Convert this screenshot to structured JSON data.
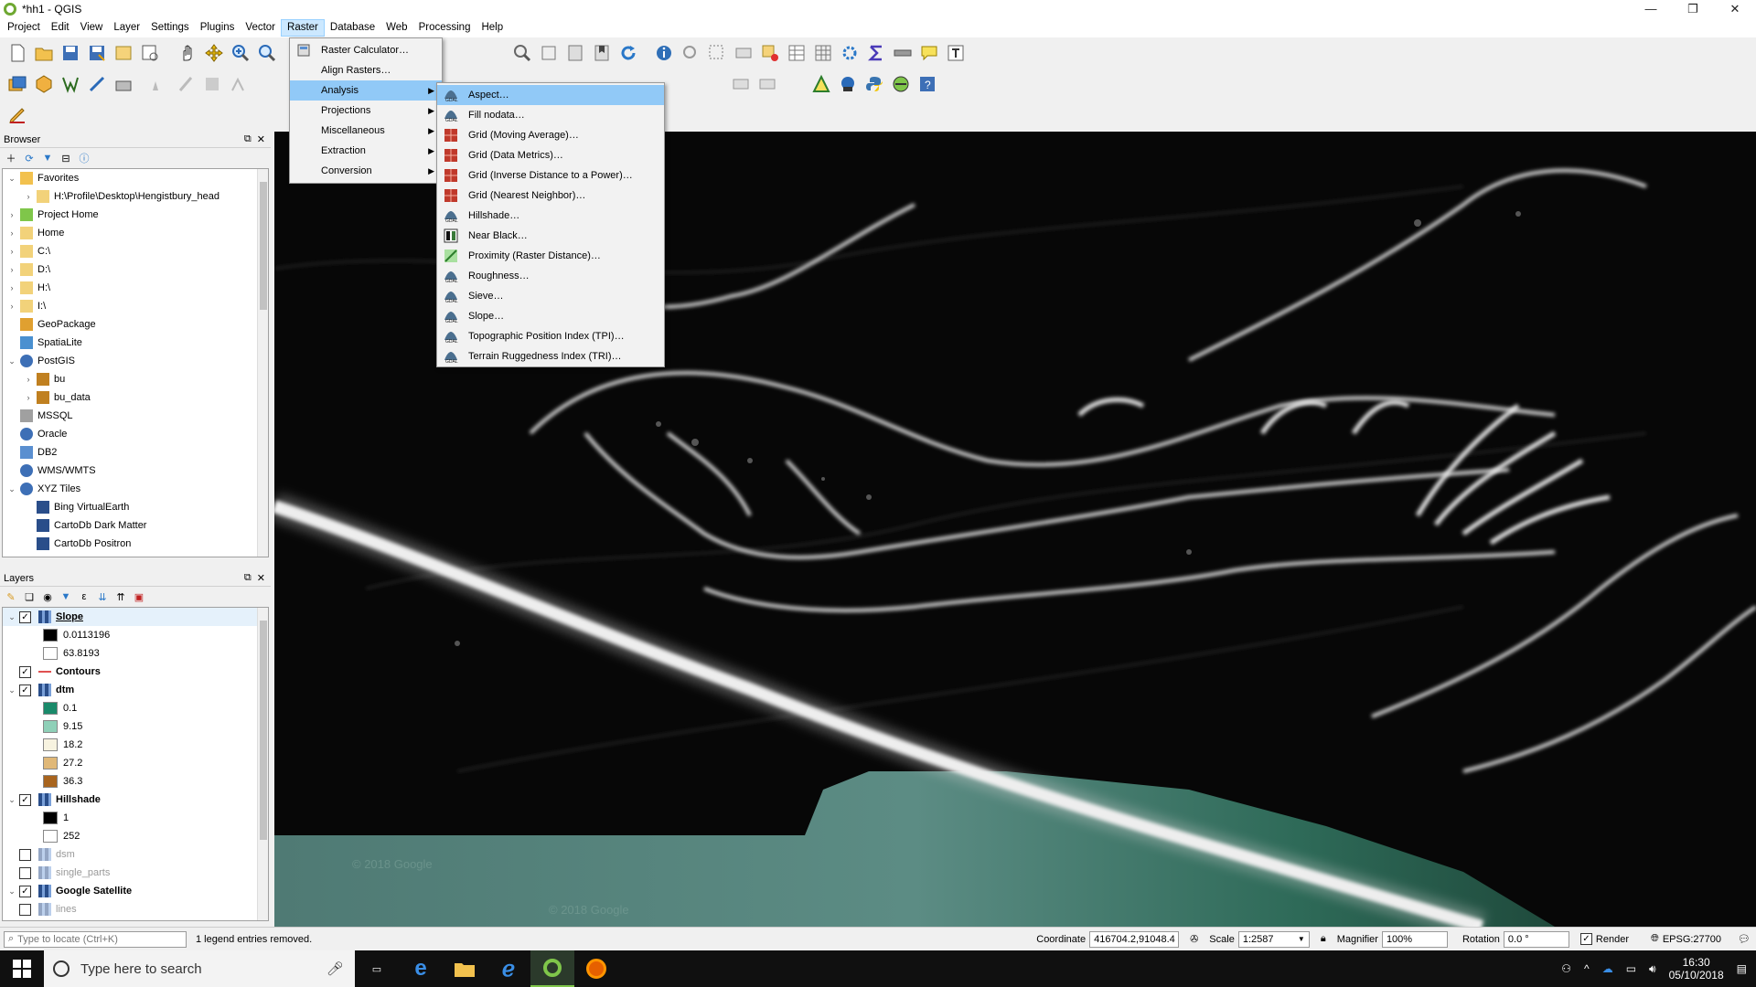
{
  "window": {
    "title": "*hh1 - QGIS",
    "controls": [
      "—",
      "❐",
      "✕"
    ]
  },
  "menubar": [
    "Project",
    "Edit",
    "View",
    "Layer",
    "Settings",
    "Plugins",
    "Vector",
    "Raster",
    "Database",
    "Web",
    "Processing",
    "Help"
  ],
  "raster_menu": {
    "items": [
      {
        "label": "Raster Calculator…",
        "has_submenu": false
      },
      {
        "label": "Align Rasters…",
        "has_submenu": false
      },
      {
        "label": "Analysis",
        "has_submenu": true
      },
      {
        "label": "Projections",
        "has_submenu": true
      },
      {
        "label": "Miscellaneous",
        "has_submenu": true
      },
      {
        "label": "Extraction",
        "has_submenu": true
      },
      {
        "label": "Conversion",
        "has_submenu": true
      }
    ]
  },
  "analysis_submenu": {
    "items": [
      "Aspect…",
      "Fill nodata…",
      "Grid (Moving Average)…",
      "Grid (Data Metrics)…",
      "Grid (Inverse Distance to a Power)…",
      "Grid (Nearest Neighbor)…",
      "Hillshade…",
      "Near Black…",
      "Proximity (Raster Distance)…",
      "Roughness…",
      "Sieve…",
      "Slope…",
      "Topographic Position Index (TPI)…",
      "Terrain Ruggedness Index (TRI)…"
    ]
  },
  "browser": {
    "title": "Browser",
    "items": [
      {
        "label": "Favorites",
        "level": 0,
        "arrow": "v",
        "icon": "star-icon"
      },
      {
        "label": "H:\\Profile\\Desktop\\Hengistbury_head",
        "level": 1,
        "arrow": ">",
        "icon": "folder-icon"
      },
      {
        "label": "Project Home",
        "level": 0,
        "arrow": ">",
        "icon": "project-home-icon"
      },
      {
        "label": "Home",
        "level": 0,
        "arrow": ">",
        "icon": "folder-icon"
      },
      {
        "label": "C:\\",
        "level": 0,
        "arrow": ">",
        "icon": "folder-icon"
      },
      {
        "label": "D:\\",
        "level": 0,
        "arrow": ">",
        "icon": "folder-icon"
      },
      {
        "label": "H:\\",
        "level": 0,
        "arrow": ">",
        "icon": "folder-icon"
      },
      {
        "label": "I:\\",
        "level": 0,
        "arrow": ">",
        "icon": "folder-icon"
      },
      {
        "label": "GeoPackage",
        "level": 0,
        "arrow": "",
        "icon": "geopackage-icon"
      },
      {
        "label": "SpatiaLite",
        "level": 0,
        "arrow": "",
        "icon": "spatialite-icon"
      },
      {
        "label": "PostGIS",
        "level": 0,
        "arrow": "v",
        "icon": "postgis-icon"
      },
      {
        "label": "bu",
        "level": 1,
        "arrow": ">",
        "icon": "connection-icon"
      },
      {
        "label": "bu_data",
        "level": 1,
        "arrow": ">",
        "icon": "connection-icon"
      },
      {
        "label": "MSSQL",
        "level": 0,
        "arrow": "",
        "icon": "mssql-icon"
      },
      {
        "label": "Oracle",
        "level": 0,
        "arrow": "",
        "icon": "oracle-icon"
      },
      {
        "label": "DB2",
        "level": 0,
        "arrow": "",
        "icon": "db2-icon"
      },
      {
        "label": "WMS/WMTS",
        "level": 0,
        "arrow": "",
        "icon": "globe-icon"
      },
      {
        "label": "XYZ Tiles",
        "level": 0,
        "arrow": "v",
        "icon": "globe-icon"
      },
      {
        "label": "Bing VirtualEarth",
        "level": 1,
        "arrow": "",
        "icon": "tile-icon"
      },
      {
        "label": "CartoDb Dark Matter",
        "level": 1,
        "arrow": "",
        "icon": "tile-icon"
      },
      {
        "label": "CartoDb Positron",
        "level": 1,
        "arrow": "",
        "icon": "tile-icon"
      }
    ]
  },
  "layers": {
    "title": "Layers",
    "items": [
      {
        "label": "Slope",
        "type": "layer",
        "checked": true,
        "arrow": "v",
        "bold": true,
        "selected": true,
        "underline": true
      },
      {
        "label": "0.0113196",
        "type": "legend",
        "color": "#000000"
      },
      {
        "label": "63.8193",
        "type": "legend",
        "color": "#ffffff"
      },
      {
        "label": "Contours",
        "type": "layer",
        "checked": true,
        "arrow": "",
        "bold": true,
        "line": "#e05050"
      },
      {
        "label": "dtm",
        "type": "layer",
        "checked": true,
        "arrow": "v",
        "bold": true
      },
      {
        "label": "0.1",
        "type": "legend",
        "color": "#1a8a6a"
      },
      {
        "label": "9.15",
        "type": "legend",
        "color": "#8fd0b8"
      },
      {
        "label": "18.2",
        "type": "legend",
        "color": "#f7f3e0"
      },
      {
        "label": "27.2",
        "type": "legend",
        "color": "#e0b878"
      },
      {
        "label": "36.3",
        "type": "legend",
        "color": "#a8641e"
      },
      {
        "label": "Hillshade",
        "type": "layer",
        "checked": true,
        "arrow": "v",
        "bold": true
      },
      {
        "label": "1",
        "type": "legend",
        "color": "#000000"
      },
      {
        "label": "252",
        "type": "legend",
        "color": "#ffffff"
      },
      {
        "label": "dsm",
        "type": "layer",
        "checked": false,
        "arrow": "",
        "dim": true
      },
      {
        "label": "single_parts",
        "type": "layer",
        "checked": false,
        "arrow": "",
        "dim": true
      },
      {
        "label": "Google Satellite",
        "type": "layer",
        "checked": true,
        "arrow": "v",
        "bold": true
      },
      {
        "label": "lines",
        "type": "layer",
        "checked": false,
        "arrow": "",
        "dim": true
      }
    ]
  },
  "map": {
    "watermark": "© 2018 Google"
  },
  "statusbar": {
    "locate_placeholder": "Type to locate (Ctrl+K)",
    "message": "1 legend entries removed.",
    "coordinate_label": "Coordinate",
    "coordinate_value": "416704.2,91048.4",
    "scale_label": "Scale",
    "scale_value": "1:2587",
    "magnifier_label": "Magnifier",
    "magnifier_value": "100%",
    "rotation_label": "Rotation",
    "rotation_value": "0.0 °",
    "render_label": "Render",
    "crs": "EPSG:27700"
  },
  "taskbar": {
    "search_placeholder": "Type here to search",
    "time": "16:30",
    "date": "05/10/2018"
  }
}
